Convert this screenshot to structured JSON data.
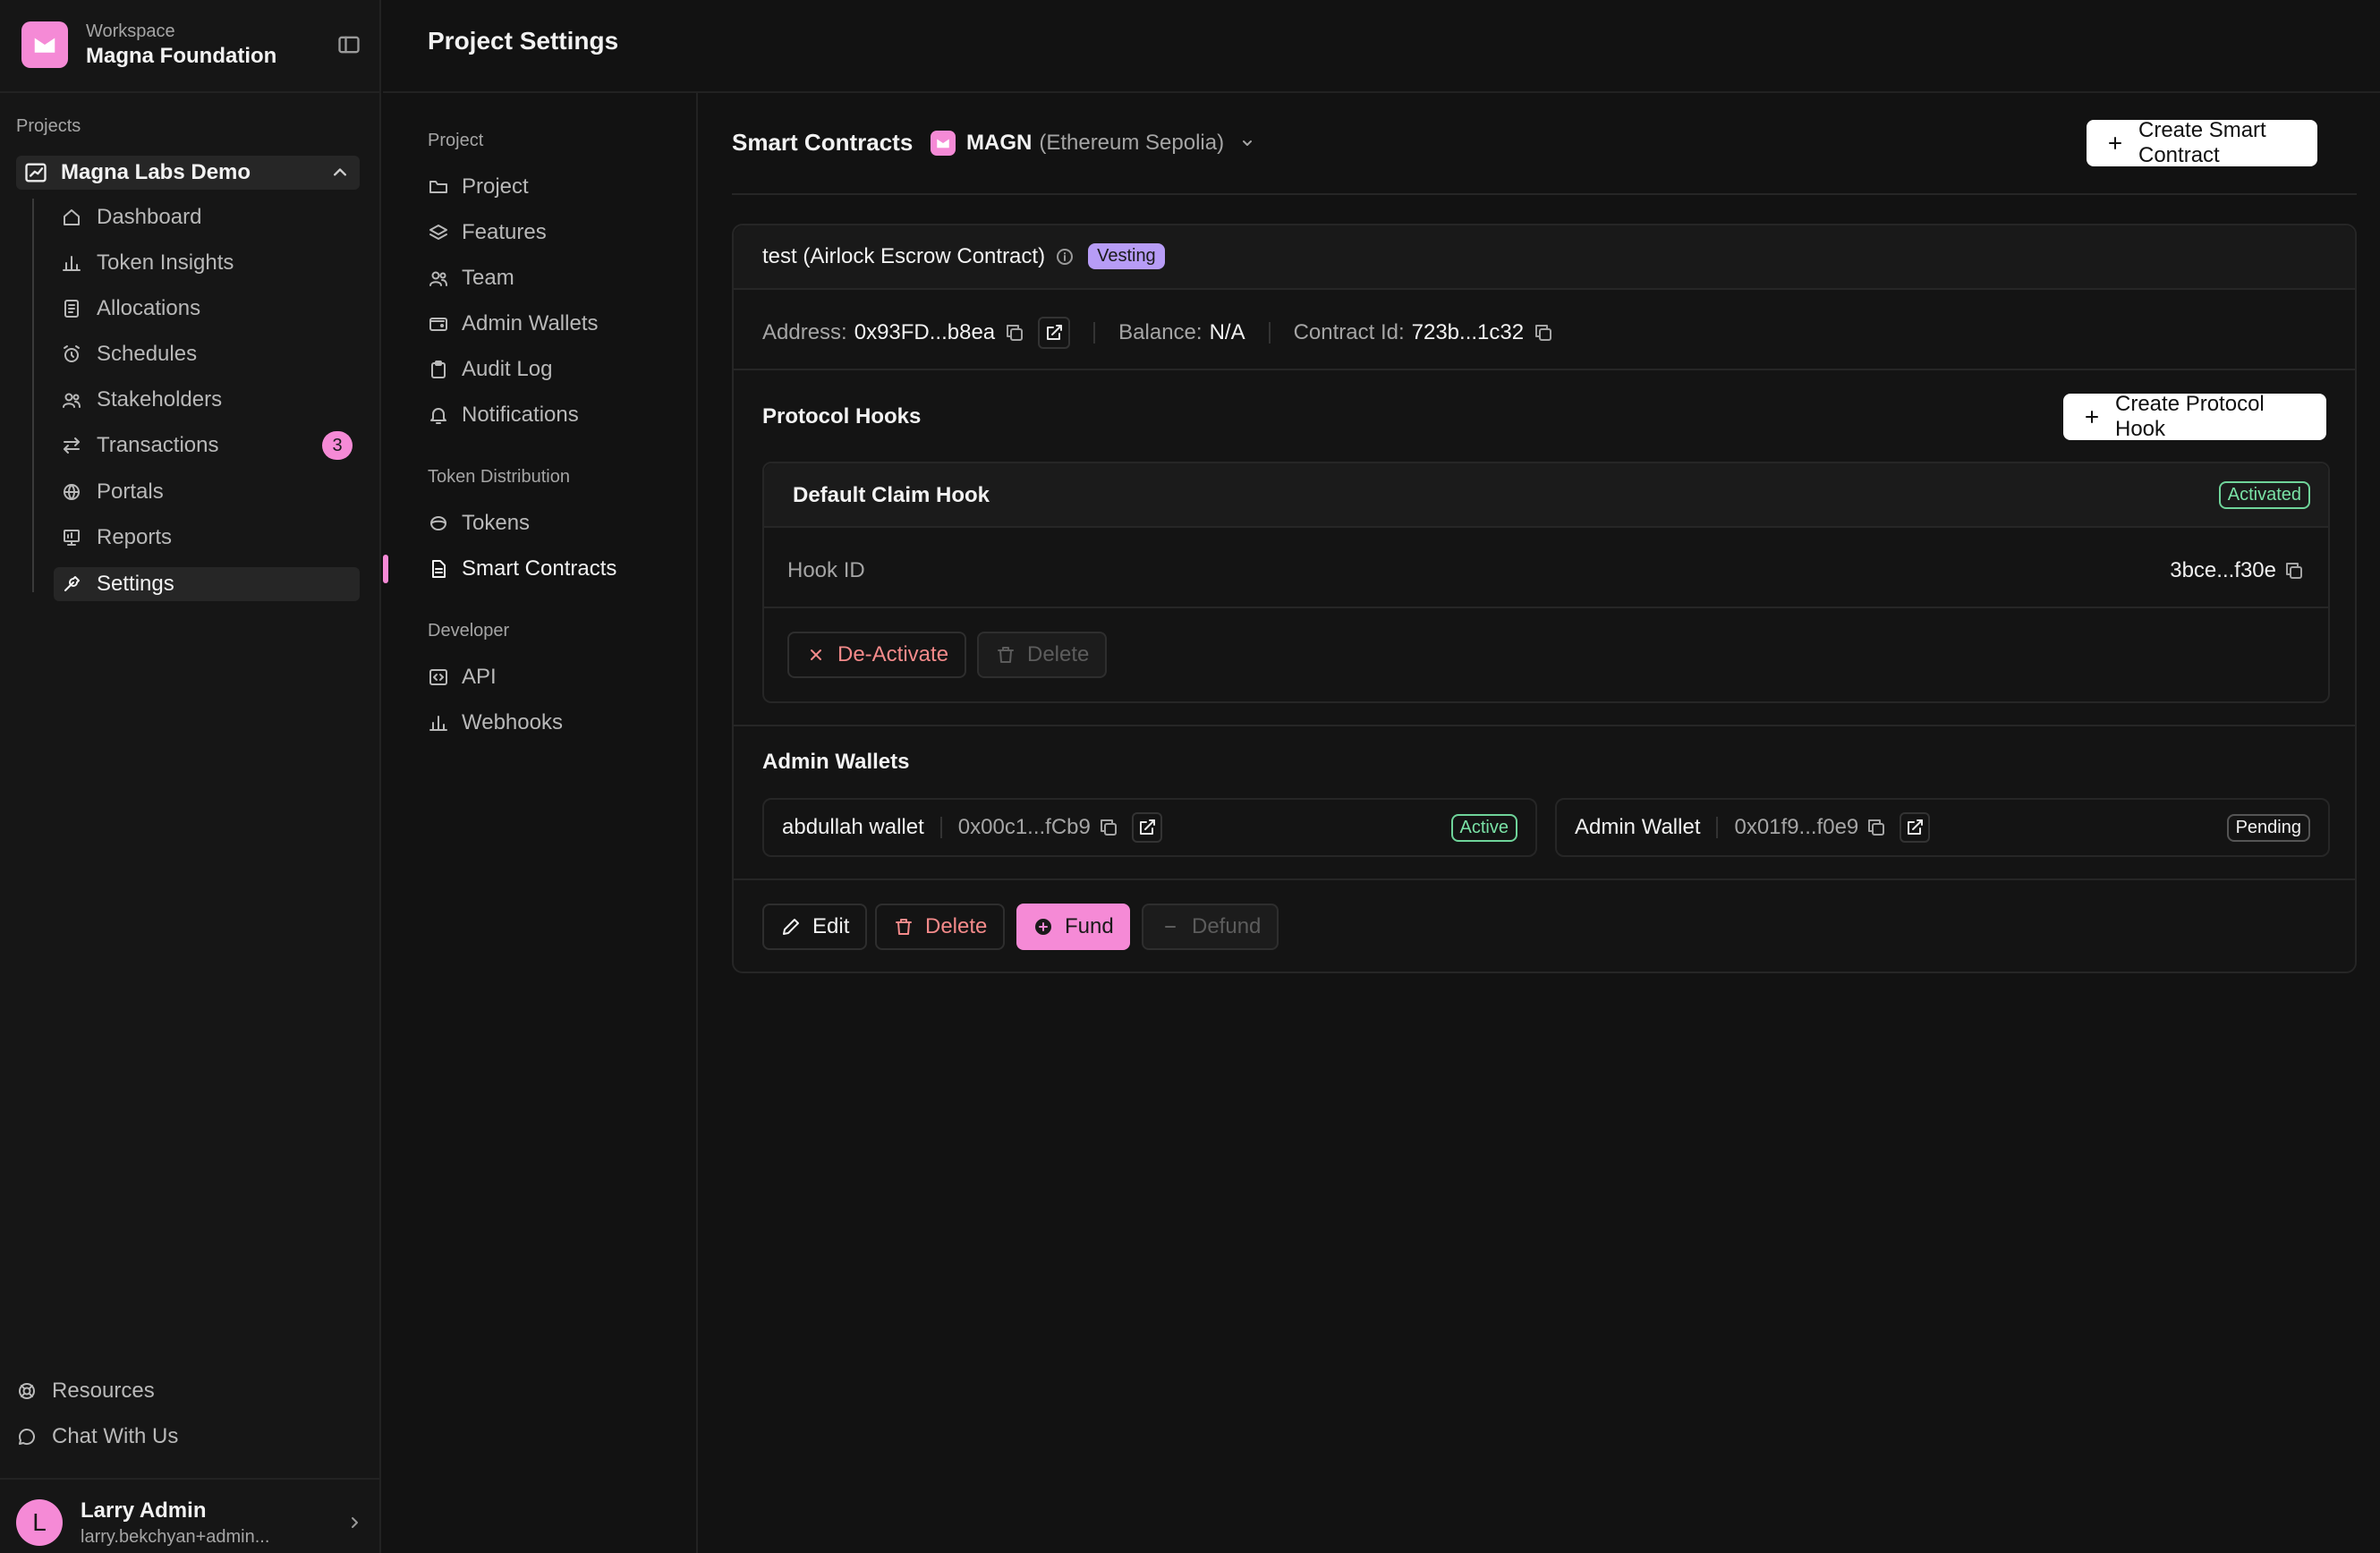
{
  "workspace": {
    "caption": "Workspace",
    "name": "Magna Foundation"
  },
  "sidebar": {
    "section_label": "Projects",
    "project_name": "Magna Labs Demo",
    "items": [
      {
        "label": "Dashboard",
        "icon": "home-icon"
      },
      {
        "label": "Token Insights",
        "icon": "bar-chart-icon"
      },
      {
        "label": "Allocations",
        "icon": "document-icon"
      },
      {
        "label": "Schedules",
        "icon": "alarm-clock-icon"
      },
      {
        "label": "Stakeholders",
        "icon": "users-icon"
      },
      {
        "label": "Transactions",
        "icon": "arrows-swap-icon",
        "badge": "3"
      },
      {
        "label": "Portals",
        "icon": "globe-icon"
      },
      {
        "label": "Reports",
        "icon": "presentation-icon"
      },
      {
        "label": "Settings",
        "icon": "wrench-icon",
        "active": true
      }
    ],
    "footer_links": [
      {
        "label": "Resources",
        "icon": "lifebuoy-icon"
      },
      {
        "label": "Chat With Us",
        "icon": "chat-bubble-icon"
      }
    ],
    "user": {
      "initial": "L",
      "name": "Larry Admin",
      "email": "larry.bekchyan+admin..."
    }
  },
  "header": {
    "title": "Project Settings"
  },
  "settings_nav": {
    "sections": [
      {
        "label": "Project",
        "items": [
          "Project",
          "Features",
          "Team",
          "Admin Wallets",
          "Audit Log",
          "Notifications"
        ]
      },
      {
        "label": "Token Distribution",
        "items": [
          "Tokens",
          "Smart Contracts"
        ]
      },
      {
        "label": "Developer",
        "items": [
          "API",
          "Webhooks"
        ]
      }
    ],
    "active_item": "Smart Contracts"
  },
  "main": {
    "title": "Smart Contracts",
    "token": {
      "symbol": "MAGN",
      "network": "(Ethereum Sepolia)"
    },
    "create_button": "Create Smart Contract",
    "contract": {
      "name": "test (Airlock Escrow Contract)",
      "type_badge": "Vesting",
      "address_label": "Address:",
      "address": "0x93FD...b8ea",
      "balance_label": "Balance:",
      "balance": "N/A",
      "contract_id_label": "Contract Id:",
      "contract_id": "723b...1c32",
      "protocol_hooks": {
        "title": "Protocol Hooks",
        "create_button": "Create Protocol Hook",
        "hook": {
          "name": "Default Claim Hook",
          "status": "Activated",
          "id_label": "Hook ID",
          "id_value": "3bce...f30e",
          "deactivate_button": "De-Activate",
          "delete_button": "Delete"
        }
      },
      "admin_wallets": {
        "title": "Admin Wallets",
        "wallets": [
          {
            "name": "abdullah wallet",
            "address": "0x00c1...fCb9",
            "status": "Active"
          },
          {
            "name": "Admin Wallet",
            "address": "0x01f9...f0e9",
            "status": "Pending"
          }
        ]
      },
      "actions": {
        "edit": "Edit",
        "delete": "Delete",
        "fund": "Fund",
        "defund": "Defund"
      }
    }
  },
  "colors": {
    "accent": "#f58ad6",
    "background": "#121212",
    "success": "#7ae2a6",
    "danger": "#f48a8a",
    "vesting": "#b79cf6"
  }
}
